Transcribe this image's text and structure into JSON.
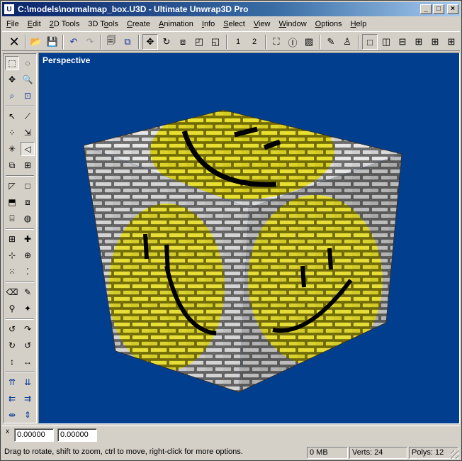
{
  "window": {
    "title": "C:\\models\\normalmap_box.U3D - Ultimate Unwrap3D Pro",
    "app_icon": "U",
    "controls": {
      "minimize": "_",
      "maximize": "□",
      "close": "×"
    }
  },
  "menu": [
    {
      "pre": "",
      "ul": "F",
      "post": "ile"
    },
    {
      "pre": "",
      "ul": "E",
      "post": "dit"
    },
    {
      "pre": "",
      "ul": "2",
      "post": "D Tools"
    },
    {
      "pre": "3D T",
      "ul": "o",
      "post": "ols"
    },
    {
      "pre": "",
      "ul": "C",
      "post": "reate"
    },
    {
      "pre": "",
      "ul": "A",
      "post": "nimation"
    },
    {
      "pre": "",
      "ul": "I",
      "post": "nfo"
    },
    {
      "pre": "",
      "ul": "S",
      "post": "elect"
    },
    {
      "pre": "",
      "ul": "V",
      "post": "iew"
    },
    {
      "pre": "",
      "ul": "W",
      "post": "indow"
    },
    {
      "pre": "",
      "ul": "O",
      "post": "ptions"
    },
    {
      "pre": "",
      "ul": "H",
      "post": "elp"
    }
  ],
  "toolbar": {
    "view_1": "1",
    "view_2": "2"
  },
  "viewport": {
    "label": "Perspective",
    "background": "#013e8e"
  },
  "coords": {
    "x_value": "0.00000",
    "y_value": "0.00000",
    "axis_label": "x"
  },
  "status": {
    "hint": "Drag to rotate, shift to zoom, ctrl to move, right-click for more options.",
    "memory": "0 MB",
    "verts": "Verts: 24",
    "polys": "Polys: 12"
  }
}
